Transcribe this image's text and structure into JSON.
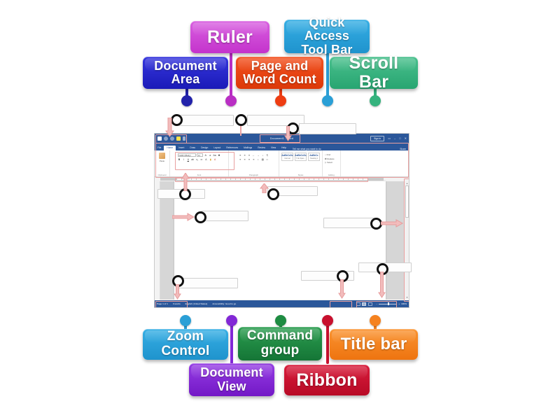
{
  "activity": {
    "type": "labelled-diagram",
    "subject": "Microsoft Word interface parts"
  },
  "labels": [
    {
      "id": "ruler",
      "text": "Ruler",
      "color": "#cc44cc",
      "dot": "#b92fc4"
    },
    {
      "id": "quick",
      "text": "Quick Access\nTool Bar",
      "line1": "Quick Access",
      "line2": "Tool Bar",
      "color": "#2a9fd6",
      "dot": "#2a9fd6"
    },
    {
      "id": "docarea",
      "text": "Document\nArea",
      "line1": "Document",
      "line2": "Area",
      "color": "#2222cc",
      "dot": "#2222aa"
    },
    {
      "id": "pagecount",
      "text": "Page and\nWord Count",
      "line1": "Page and",
      "line2": "Word Count",
      "color": "#e8431a",
      "dot": "#ee3d12"
    },
    {
      "id": "scrollbar",
      "text": "Scroll Bar",
      "color": "#35b37e",
      "dot": "#35b37e"
    },
    {
      "id": "zoom",
      "text": "Zoom Control",
      "color": "#2a9fd6",
      "dot": "#2a9fd6"
    },
    {
      "id": "docview",
      "text": "Document\nView",
      "line1": "Document",
      "line2": "View",
      "color": "#8228d6",
      "dot": "#8228d6"
    },
    {
      "id": "cmdgroup",
      "text": "Command\ngroup",
      "line1": "Command",
      "line2": "group",
      "color": "#1e8c42",
      "dot": "#1e8c42"
    },
    {
      "id": "ribbon",
      "text": "Ribbon",
      "color": "#c8102e",
      "dot": "#c8102e"
    },
    {
      "id": "titlebar",
      "text": "Title bar",
      "color": "#f5821f",
      "dot": "#f5821f"
    }
  ],
  "word": {
    "title": "Document1 - Word",
    "sign_in": "Sign in",
    "window_buttons": {
      "ribbon_display": "▭",
      "minimize": "–",
      "maximize": "□",
      "close": "✕"
    },
    "quick_access": [
      "save-icon",
      "undo-icon",
      "redo-icon",
      "touch-mode-icon",
      "customize-icon"
    ],
    "tabs": [
      "File",
      "Home",
      "Insert",
      "Draw",
      "Design",
      "Layout",
      "References",
      "Mailings",
      "Review",
      "View",
      "Help"
    ],
    "active_tab": "Home",
    "tell_me": "Tell me what you want to do",
    "share": "Share",
    "ribbon_groups": [
      {
        "name": "Clipboard",
        "big_button": "Paste"
      },
      {
        "name": "Font",
        "font_name": "Calibri (Body)",
        "font_size": "11"
      },
      {
        "name": "Paragraph"
      },
      {
        "name": "Styles",
        "items": [
          {
            "sample": "AaBbCcDc",
            "name": "Normal"
          },
          {
            "sample": "AaBbCcDc",
            "name": "T No Spac..."
          },
          {
            "sample": "AaBbCc",
            "name": "Heading 1"
          }
        ]
      },
      {
        "name": "Editing",
        "commands": [
          "Find",
          "Replace",
          "Select"
        ]
      }
    ],
    "status_bar": {
      "page": "Page 1 of 1",
      "words": "0 words",
      "language": "English (United States)",
      "accessibility": "Accessibility: Good to go",
      "views": [
        "read-mode-icon",
        "print-layout-icon",
        "web-layout-icon"
      ],
      "active_view": "print-layout-icon",
      "zoom_out": "–",
      "zoom_in": "+",
      "zoom_value": "100%"
    }
  },
  "targets": [
    {
      "id": "t1",
      "answer_for": "quick-access-tool-bar"
    },
    {
      "id": "t2",
      "answer_for": "title-bar"
    },
    {
      "id": "t3",
      "answer_for": "ribbon"
    },
    {
      "id": "t4",
      "answer_for": "command-group"
    },
    {
      "id": "t5",
      "answer_for": "ruler"
    },
    {
      "id": "t6",
      "answer_for": "document-area"
    },
    {
      "id": "t7",
      "answer_for": "scroll-bar"
    },
    {
      "id": "t8",
      "answer_for": "page-and-word-count"
    },
    {
      "id": "t9",
      "answer_for": "document-view"
    },
    {
      "id": "t10",
      "answer_for": "zoom-control"
    }
  ]
}
